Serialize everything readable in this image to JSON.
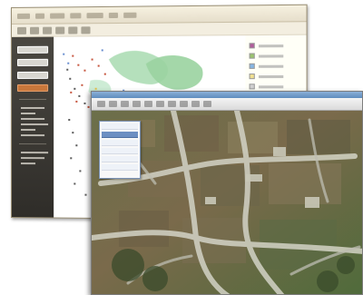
{
  "back_window": {
    "menu_items": 7,
    "toolbar_buttons": 6,
    "panel_buttons": [
      "white",
      "white",
      "white",
      "orange"
    ],
    "legend_swatches": [
      "#b05d9b",
      "#9ac36d",
      "#86b5e2",
      "#f0e090",
      "#d0d0d0"
    ],
    "colors": {
      "panel_dark": "#3b3834",
      "accent_orange": "#c9773b",
      "map_green": "#9ad3a0"
    }
  },
  "front_window": {
    "toolbar_icons": 10,
    "sidebar_items": [
      "normal",
      "selected",
      "normal",
      "normal",
      "normal",
      "normal"
    ],
    "colors": {
      "titlebar": "#6f98c7",
      "selection": "#6c8fc2",
      "road_gray": "#cfcfc3",
      "terrain_green": "#4f6b3b"
    }
  }
}
